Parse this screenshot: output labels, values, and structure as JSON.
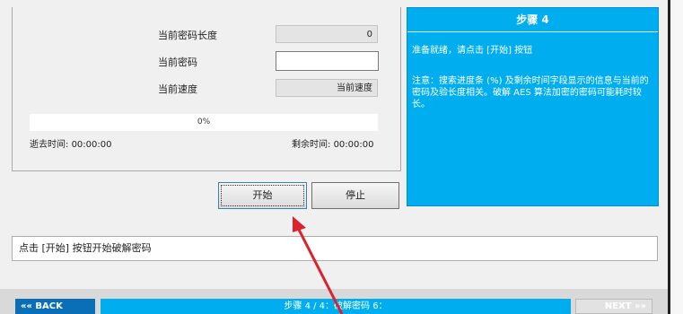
{
  "progress_panel": {
    "length_label": "当前密码长度",
    "length_value": "0",
    "password_label": "当前密码",
    "password_value": "",
    "speed_label": "当前速度",
    "speed_value": "当前速度",
    "progress_text": "0%",
    "progress_fraction": 0,
    "elapsed_label": "逝去时间:",
    "elapsed_value": "00:00:00",
    "remaining_label": "剩余时间:",
    "remaining_value": "00:00:00"
  },
  "buttons": {
    "start": "开始",
    "stop": "停止"
  },
  "step_panel": {
    "title": "步骤 4",
    "ready_text": "准备就绪，请点击 [开始] 按钮",
    "note_text": "注意：搜索进度条 (%) 及剩余时间字段显示的信息与当前的密码及验长度相关。破解 AES 算法加密的密码可能耗时较长。"
  },
  "status_text": "点击 [开始] 按钮开始破解密码",
  "footer": {
    "back_label": "BACK",
    "step_label": "步骤 4 / 4：破解密码 6：",
    "next_label": "NEXT"
  },
  "colors": {
    "accent": "#00aeef",
    "arrow": "#d9232e"
  }
}
